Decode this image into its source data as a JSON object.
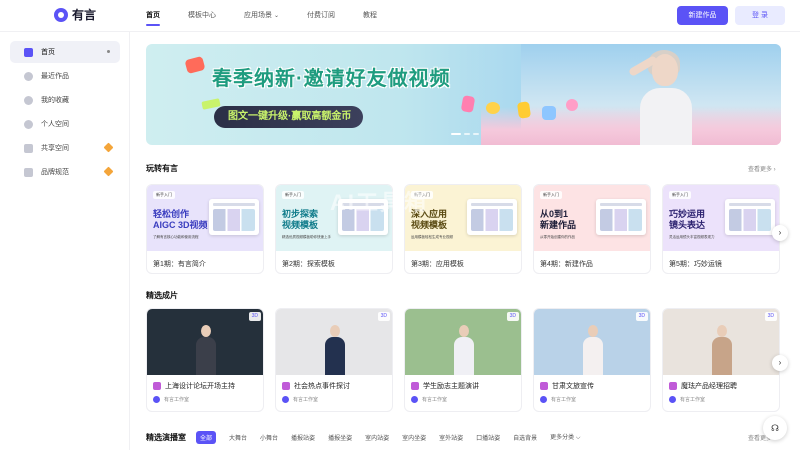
{
  "brand": {
    "name": "有言"
  },
  "nav": {
    "items": [
      {
        "label": "首页"
      },
      {
        "label": "模板中心"
      },
      {
        "label": "应用场景"
      },
      {
        "label": "付费订阅"
      },
      {
        "label": "教程"
      }
    ],
    "new_button": "新建作品",
    "login_button": "登 录"
  },
  "sidebar": {
    "items": [
      {
        "label": "首页",
        "icon": "home-icon"
      },
      {
        "label": "最近作品",
        "icon": "clock-icon"
      },
      {
        "label": "我的收藏",
        "icon": "star-icon"
      },
      {
        "label": "个人空间",
        "icon": "user-icon"
      },
      {
        "label": "共享空间",
        "icon": "grid-icon"
      },
      {
        "label": "品牌规范",
        "icon": "crown-icon"
      }
    ]
  },
  "banner": {
    "title": "春季纳新·邀请好友做视频",
    "pill": "图文一键升级·赢取高额金币"
  },
  "play_section": {
    "title": "玩转有言",
    "more": "查看更多 ›",
    "cards": [
      {
        "badge": "新手入门",
        "head_line1": "轻松创作",
        "head_line2": "AIGC 3D视频",
        "sub": "了解有言核心功能和使用流程",
        "caption": "第1期：有言简介",
        "color": "#e8e3fb",
        "accent": "#3a3dbf"
      },
      {
        "badge": "新手入门",
        "head_line1": "初步探索",
        "head_line2": "视频模板",
        "sub": "精选优质视频模板助你快速上手",
        "caption": "第2期：探索模板",
        "color": "#dff3f4",
        "accent": "#0f7b8a"
      },
      {
        "badge": "新手入门",
        "head_line1": "深入应用",
        "head_line2": "视频模板",
        "sub": "运用模板轻松生成专业视频",
        "caption": "第3期：应用模板",
        "color": "#fbf3d4",
        "accent": "#5a4a12"
      },
      {
        "badge": "新手入门",
        "head_line1": "从0到1",
        "head_line2": "新建作品",
        "sub": "从零开始创建你的作品",
        "caption": "第4期：新建作品",
        "color": "#fde3e4",
        "accent": "#1f1f3a"
      },
      {
        "badge": "新手入门",
        "head_line1": "巧妙运用",
        "head_line2": "镜头表达",
        "sub": "灵活运用镜头丰富视频表现力",
        "caption": "第5期：巧妙运镜",
        "color": "#ece2fb",
        "accent": "#2c2270"
      }
    ]
  },
  "featured_section": {
    "title": "精选成片",
    "cards": [
      {
        "title": "上海设计论坛开场主持",
        "author": "有言工作室",
        "badge": "3D",
        "bg": "#25303b",
        "body": "#3b3f4a"
      },
      {
        "title": "社会热点事件探讨",
        "author": "有言工作室",
        "badge": "3D",
        "bg": "#e6e6e8",
        "body": "#23314f"
      },
      {
        "title": "学生励志主题演讲",
        "author": "有言工作室",
        "badge": "3D",
        "bg": "#9bbf8f",
        "body": "#f0f0f5"
      },
      {
        "title": "甘肃文旅宣传",
        "author": "有言工作室",
        "badge": "3D",
        "bg": "#b9d2e8",
        "body": "#f4f0f0"
      },
      {
        "title": "魔珐产品经理招聘",
        "author": "有言工作室",
        "badge": "3D",
        "bg": "#e9e3dd",
        "body": "#c7a489"
      }
    ]
  },
  "anchor_section": {
    "title": "精选演播室",
    "tabs": [
      "全部",
      "大舞台",
      "小舞台",
      "播报站姿",
      "播报坐姿",
      "室内站姿",
      "室内坐姿",
      "室外站姿",
      "口播站姿",
      "自选背景",
      "更多分类 ⌵"
    ],
    "more": "查看更多 ›"
  },
  "watermark": "AI工具箱"
}
